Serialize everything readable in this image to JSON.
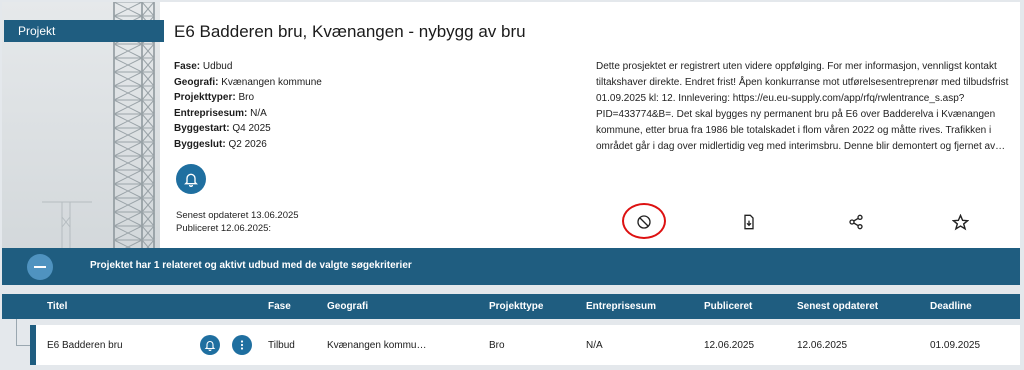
{
  "project_tag": "Projekt",
  "title": "E6 Badderen bru, Kvænangen - nybygg av bru",
  "meta": [
    {
      "label": "Fase:",
      "value": "Udbud"
    },
    {
      "label": "Geografi:",
      "value": "Kvænangen kommune"
    },
    {
      "label": "Projekttyper:",
      "value": "Bro"
    },
    {
      "label": "Entreprisesum:",
      "value": "N/A"
    },
    {
      "label": "Byggestart:",
      "value": "Q4 2025"
    },
    {
      "label": "Byggeslut:",
      "value": "Q2 2026"
    }
  ],
  "description": "Dette prosjektet er registrert uten videre oppfølging. For mer informasjon, vennligst kontakt tiltakshaver direkte. Endret frist! Åpen konkurranse mot utførelsesentreprenør med tilbuds­frist 01.09.2025 kl: 12. Innlevering: https://eu.eu-supply.com/app/rfq/rwlentrance_s.asp?PID=433774&B=.   Det skal bygges ny permanent bru på E6 over Badderelva i Kvænangen kommune, etter brua fra 1986 ble totalskadet i flom våren 2022 og måtte rives. Trafikken i området går i dag over midlertidig veg med interimsbru. Denne blir demontert og fjernet av…",
  "updated": "Senest opdateret 13.06.2025",
  "published": "Publiceret 12.06.2025:",
  "icons": {
    "bell": "bell-icon",
    "hide": "block-icon",
    "export": "file-download-icon",
    "share": "share-icon",
    "favorite": "star-icon"
  },
  "banner_text": "Projektet har 1 relateret og aktivt udbud med de valgte søgekriterier",
  "table": {
    "headers": [
      "Titel",
      "Fase",
      "Geografi",
      "Projekttype",
      "Entreprisesum",
      "Publiceret",
      "Senest opdateret",
      "Deadline"
    ],
    "rows": [
      {
        "titel": "E6 Badderen bru",
        "fase": "Tilbud",
        "geografi": "Kvænangen kommu…",
        "projekttype": "Bro",
        "entreprisesum": "N/A",
        "publiceret": "12.06.2025",
        "senest": "12.06.2025",
        "deadline": "01.09.2025"
      }
    ]
  },
  "colors": {
    "primary": "#1f5d80",
    "accent": "#1f6fa0",
    "highlight": "#dd1111"
  }
}
